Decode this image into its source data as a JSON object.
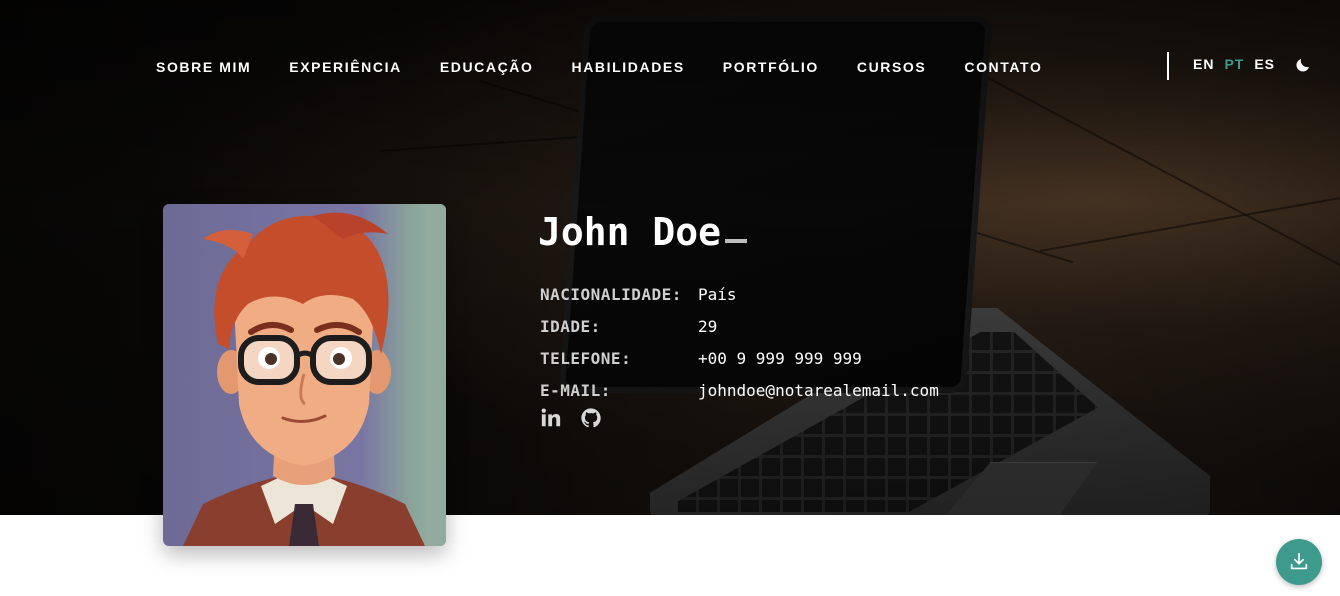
{
  "nav": {
    "items": [
      {
        "label": "SOBRE MIM"
      },
      {
        "label": "EXPERIÊNCIA"
      },
      {
        "label": "EDUCAÇÃO"
      },
      {
        "label": "HABILIDADES"
      },
      {
        "label": "PORTFÓLIO"
      },
      {
        "label": "CURSOS"
      },
      {
        "label": "CONTATO"
      }
    ],
    "languages": [
      {
        "code": "EN",
        "active": false
      },
      {
        "code": "PT",
        "active": true
      },
      {
        "code": "ES",
        "active": false
      }
    ],
    "theme_icon": "moon-icon"
  },
  "profile": {
    "name": "John Doe",
    "fields": [
      {
        "label": "NACIONALIDADE:",
        "value": "País"
      },
      {
        "label": "IDADE:",
        "value": "29"
      },
      {
        "label": "TELEFONE:",
        "value": "+00 9 999 999 999"
      },
      {
        "label": "E-MAIL:",
        "value": "johndoe@notarealemail.com"
      }
    ],
    "social_icons": [
      "linkedin-icon",
      "github-icon"
    ]
  },
  "fab": {
    "icon": "download-icon"
  },
  "colors": {
    "accent": "#3e9a8c",
    "text": "#ffffff",
    "label": "#cfcfcf"
  }
}
